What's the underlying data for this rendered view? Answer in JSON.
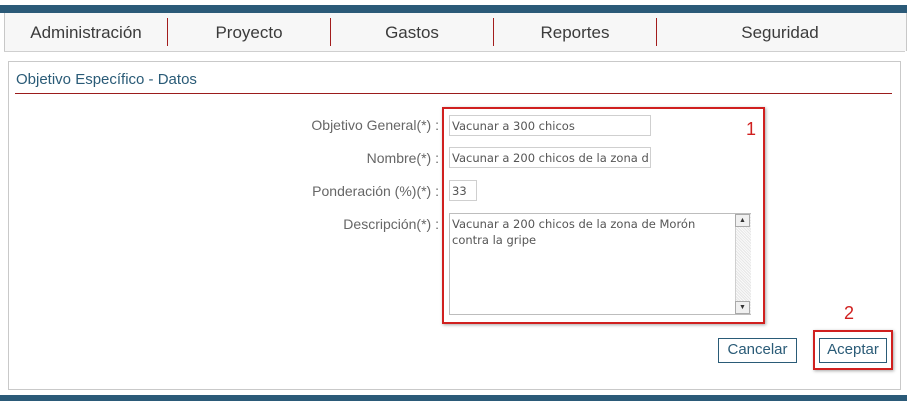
{
  "nav": {
    "items": [
      {
        "label": "Administración"
      },
      {
        "label": "Proyecto"
      },
      {
        "label": "Gastos"
      },
      {
        "label": "Reportes"
      },
      {
        "label": "Seguridad"
      }
    ]
  },
  "panel": {
    "title": "Objetivo Específico - Datos"
  },
  "form": {
    "objetivo_general": {
      "label": "Objetivo General(*) :",
      "value": "Vacunar a 300 chicos"
    },
    "nombre": {
      "label": "Nombre(*) :",
      "value": "Vacunar a 200 chicos de la zona d"
    },
    "ponderacion": {
      "label": "Ponderación (%)(*) :",
      "value": "33"
    },
    "descripcion": {
      "label": "Descripción(*) :",
      "value": "Vacunar a 200 chicos de la zona de Morón contra la gripe"
    }
  },
  "annotations": {
    "one": "1",
    "two": "2",
    "color": "#d0201f"
  },
  "buttons": {
    "cancel": "Cancelar",
    "accept": "Aceptar"
  },
  "colors": {
    "brand": "#2b5a78",
    "accent_rule": "#9b1c1c"
  }
}
